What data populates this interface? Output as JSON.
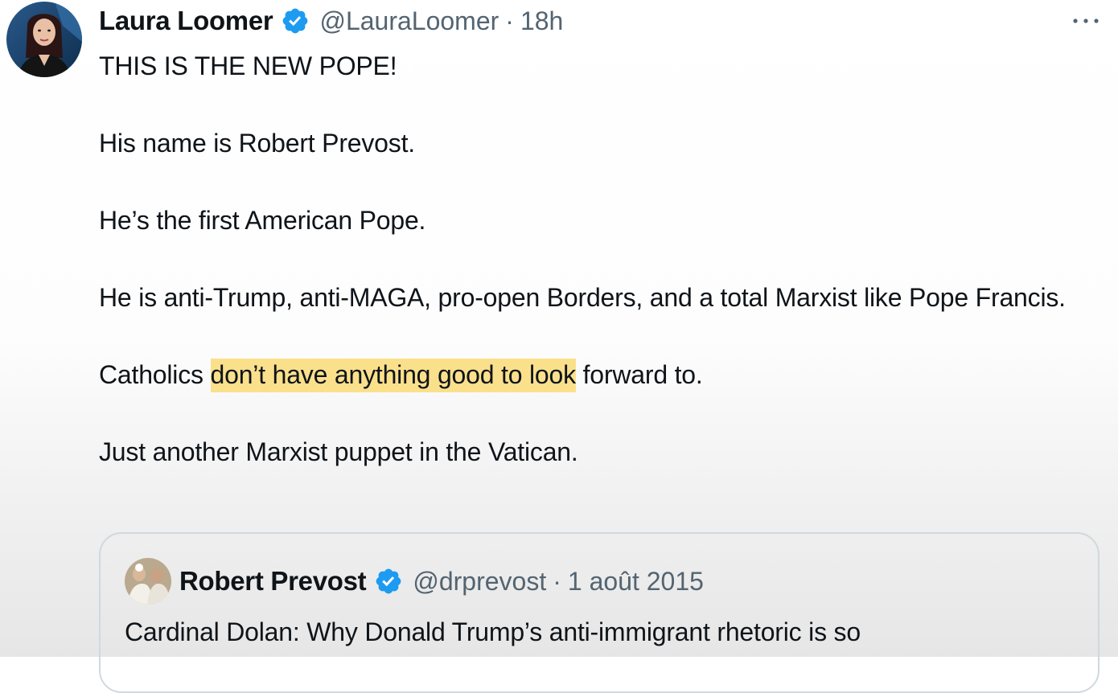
{
  "tweet": {
    "author": {
      "name": "Laura Loomer",
      "handle": "@LauraLoomer",
      "time": "18h"
    },
    "separator": "·",
    "body": {
      "p1": "THIS IS THE NEW POPE!",
      "p2": "His name is Robert Prevost.",
      "p3": "He’s the first American Pope.",
      "p4": "He is anti-Trump, anti-MAGA, pro-open Borders, and a total Marxist like Pope Francis.",
      "p5_before": "Catholics ",
      "p5_highlight": "don’t have anything good to look",
      "p5_after": " forward to.",
      "p6": "Just another Marxist puppet in the Vatican."
    },
    "highlight_color": "#fbe08c",
    "more_icon": "more-horizontal-icon"
  },
  "quoted_tweet": {
    "author": {
      "name": "Robert Prevost",
      "handle": "@drprevost",
      "time": "1 août 2015"
    },
    "separator": "·",
    "text": "Cardinal Dolan: Why Donald Trump’s anti-immigrant rhetoric is so"
  },
  "colors": {
    "verified_badge": "#1d9bf0",
    "secondary_text": "#536471",
    "primary_text": "#0f1419"
  }
}
